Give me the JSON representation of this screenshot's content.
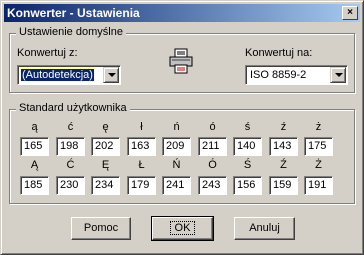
{
  "window": {
    "title": "Konwerter - Ustawienia",
    "close_symbol": "×"
  },
  "defaults_group": {
    "label": "Ustawienie domyślne",
    "from_label": "Konwertuj z:",
    "from_value": "(Autodetekcja)",
    "to_label": "Konwertuj na:",
    "to_value": "ISO 8859-2",
    "icon": "printer-convert-icon"
  },
  "user_group": {
    "label": "Standard użytkownika",
    "lower": [
      {
        "char": "ą",
        "value": "165"
      },
      {
        "char": "ć",
        "value": "198"
      },
      {
        "char": "ę",
        "value": "202"
      },
      {
        "char": "ł",
        "value": "163"
      },
      {
        "char": "ń",
        "value": "209"
      },
      {
        "char": "ó",
        "value": "211"
      },
      {
        "char": "ś",
        "value": "140"
      },
      {
        "char": "ź",
        "value": "143"
      },
      {
        "char": "ż",
        "value": "175"
      }
    ],
    "upper": [
      {
        "char": "Ą",
        "value": "185"
      },
      {
        "char": "Ć",
        "value": "230"
      },
      {
        "char": "Ę",
        "value": "234"
      },
      {
        "char": "Ł",
        "value": "179"
      },
      {
        "char": "Ń",
        "value": "241"
      },
      {
        "char": "Ó",
        "value": "243"
      },
      {
        "char": "Ś",
        "value": "156"
      },
      {
        "char": "Ź",
        "value": "159"
      },
      {
        "char": "Ż",
        "value": "191"
      }
    ]
  },
  "buttons": {
    "help": "Pomoc",
    "ok": "OK",
    "cancel": "Anuluj"
  }
}
